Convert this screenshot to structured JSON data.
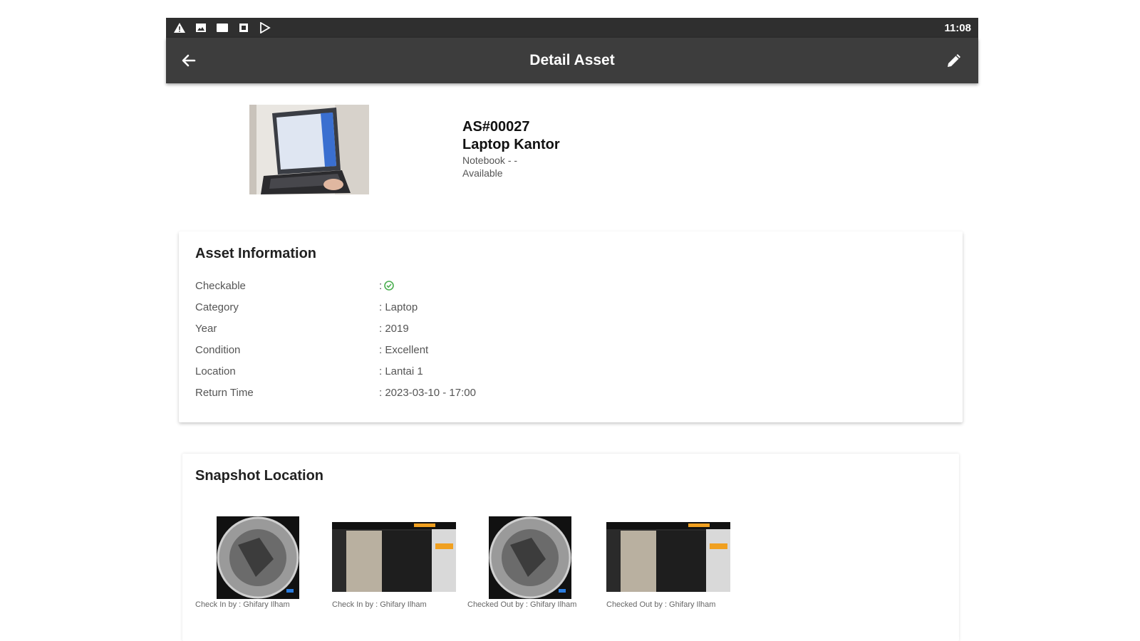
{
  "statusbar": {
    "time": "11:08",
    "icons": [
      "warning-icon",
      "image-icon",
      "message-icon",
      "square-icon",
      "play-store-icon"
    ]
  },
  "appbar": {
    "title": "Detail Asset",
    "back_icon": "arrow-back-icon",
    "edit_icon": "pencil-icon"
  },
  "asset": {
    "code": "AS#00027",
    "name": "Laptop Kantor",
    "subtitle": "Notebook - -",
    "status": "Available"
  },
  "info": {
    "title": "Asset Information",
    "rows": [
      {
        "label": "Checkable",
        "value": ":",
        "icon": "check-circle-icon"
      },
      {
        "label": "Category",
        "value": ": Laptop"
      },
      {
        "label": "Year",
        "value": ": 2019"
      },
      {
        "label": "Condition",
        "value": ": Excellent"
      },
      {
        "label": "Location",
        "value": ": Lantai 1"
      },
      {
        "label": "Return Time",
        "value": ": 2023-03-10 - 17:00"
      }
    ]
  },
  "snapshots": {
    "title": "Snapshot Location",
    "items": [
      {
        "caption": "Check In by : Ghifary Ilham"
      },
      {
        "caption": "Check In by : Ghifary Ilham"
      },
      {
        "caption": "Checked Out by : Ghifary Ilham"
      },
      {
        "caption": "Checked Out by : Ghifary Ilham"
      }
    ]
  },
  "colors": {
    "statusbar_bg": "#2f2f2f",
    "appbar_bg": "#3d3d3d",
    "check_green": "#4caf50"
  }
}
